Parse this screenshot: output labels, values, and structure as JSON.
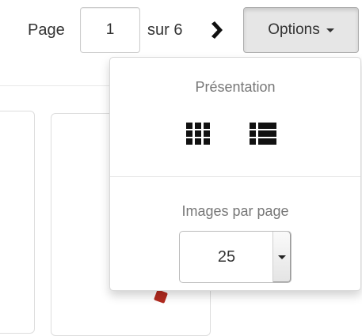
{
  "pagination": {
    "page_label": "Page",
    "current_page": "1",
    "total_label": "sur 6"
  },
  "options": {
    "label": "Options"
  },
  "dropdown": {
    "presentation_heading": "Présentation",
    "per_page_heading": "Images par page",
    "per_page_value": "25"
  },
  "icons": {
    "next": "chevron-right-icon",
    "options_caret": "caret-down-icon",
    "grid_view": "grid-view-icon",
    "list_view": "list-view-icon",
    "select_caret": "caret-down-icon"
  }
}
